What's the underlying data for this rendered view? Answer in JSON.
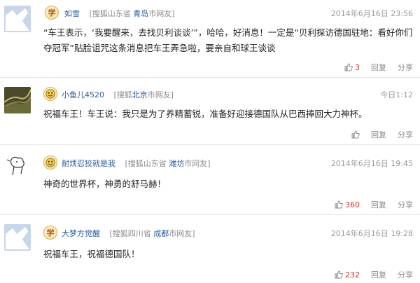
{
  "comments": [
    {
      "badge": "学",
      "username": "如雪",
      "source_prefix": "[搜狐山东省 ",
      "source_city": "青岛",
      "source_suffix": "市网友]",
      "time": "2014年6月16日 23:56",
      "text": "“车王表示，‘我要醒来，去找贝利谈谈’”，哈哈，好消息！一定是“贝利探访德国驻地：看好你们夺冠军”贴脸诅咒这条消息把车王弄急啦，要亲自和球王谈谈",
      "likes": "3",
      "reply": "回复",
      "share": "分享"
    },
    {
      "badge": "",
      "username": "小鱼儿4520",
      "source_prefix": "[搜狐",
      "source_city": "北京",
      "source_suffix": "市网友]",
      "time": "今日1:12",
      "text": "祝福车王！车王说：我只是为了养精蓄锐，准备好迎接德国队从巴西捧回大力神杯。",
      "likes": "",
      "reply": "回复",
      "share": "分享"
    },
    {
      "badge": "",
      "username": "耐烦忍狡就是我",
      "source_prefix": "[搜狐山东省 ",
      "source_city": "潍坊",
      "source_suffix": "市网友]",
      "time": "2014年6月16日 19:45",
      "text": "神奇的世界杯，神勇的舒马赫！",
      "likes": "360",
      "reply": "回复",
      "share": "分享"
    },
    {
      "badge": "学",
      "username": "大梦方觉醒",
      "source_prefix": "[搜狐四川省 ",
      "source_city": "成都",
      "source_suffix": "市网友]",
      "time": "2014年6月16日 19:28",
      "text": "祝福车王，祝福德国队！",
      "likes": "232",
      "reply": "回复",
      "share": "分享"
    }
  ],
  "colors": {
    "username": "#2a5a9e",
    "meta": "#8a8a8a",
    "like_count": "#c0392b"
  }
}
